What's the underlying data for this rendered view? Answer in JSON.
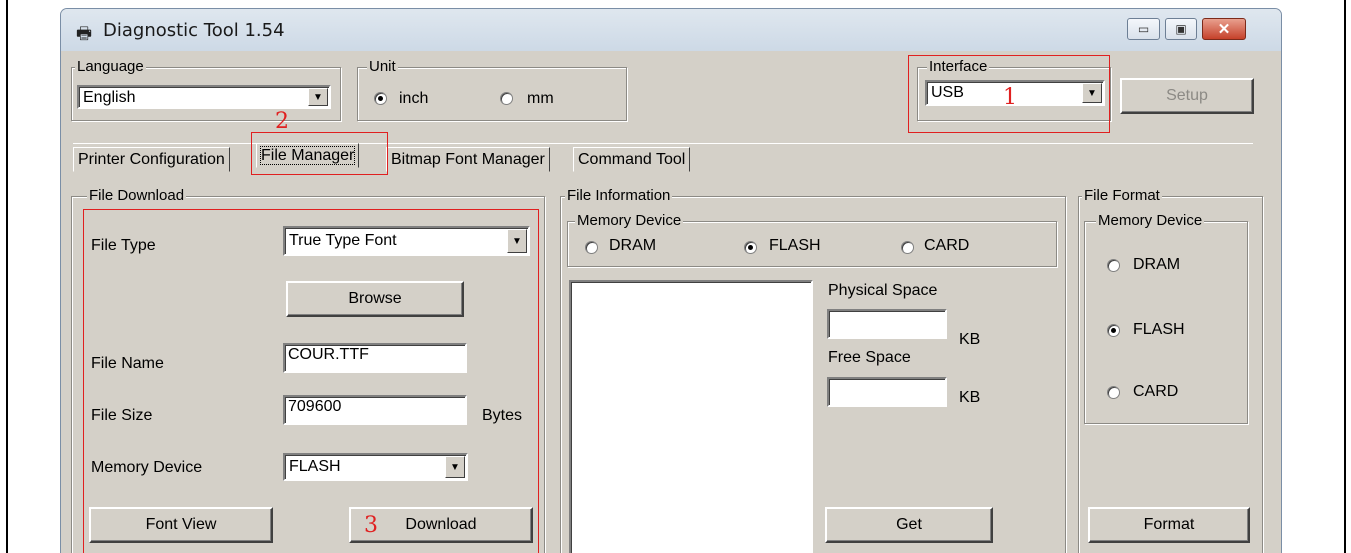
{
  "window": {
    "title": "Diagnostic Tool 1.54",
    "icon": "printer-icon",
    "minimize_glyph": "▭",
    "maximize_glyph": "▣",
    "close_glyph": "✕"
  },
  "language": {
    "group_label": "Language",
    "value": "English"
  },
  "unit": {
    "group_label": "Unit",
    "options": [
      "inch",
      "mm"
    ],
    "selected": "inch"
  },
  "interface": {
    "group_label": "Interface",
    "value": "USB",
    "setup_label": "Setup"
  },
  "tabs": [
    {
      "label": "Printer Configuration",
      "active": false
    },
    {
      "label": "File Manager",
      "active": true
    },
    {
      "label": "Bitmap Font Manager",
      "active": false
    },
    {
      "label": "Command Tool",
      "active": false
    }
  ],
  "file_download": {
    "group_label": "File Download",
    "file_type_label": "File Type",
    "file_type_value": "True Type Font",
    "browse_label": "Browse",
    "file_name_label": "File Name",
    "file_name_value": "COUR.TTF",
    "file_size_label": "File Size",
    "file_size_value": "709600",
    "file_size_unit": "Bytes",
    "memory_device_label": "Memory Device",
    "memory_device_value": "FLASH",
    "font_view_label": "Font View",
    "download_label": "Download"
  },
  "file_information": {
    "group_label": "File Information",
    "memory_device_label": "Memory Device",
    "options": [
      "DRAM",
      "FLASH",
      "CARD"
    ],
    "selected": "FLASH",
    "physical_space_label": "Physical Space",
    "free_space_label": "Free Space",
    "kb_unit": "KB",
    "get_label": "Get"
  },
  "file_format": {
    "group_label": "File Format",
    "memory_device_label": "Memory Device",
    "options": [
      "DRAM",
      "FLASH",
      "CARD"
    ],
    "selected": "FLASH",
    "format_label": "Format"
  },
  "annotations": {
    "step1": "1",
    "step2": "2",
    "step3": "3",
    "color": "#e02020"
  }
}
